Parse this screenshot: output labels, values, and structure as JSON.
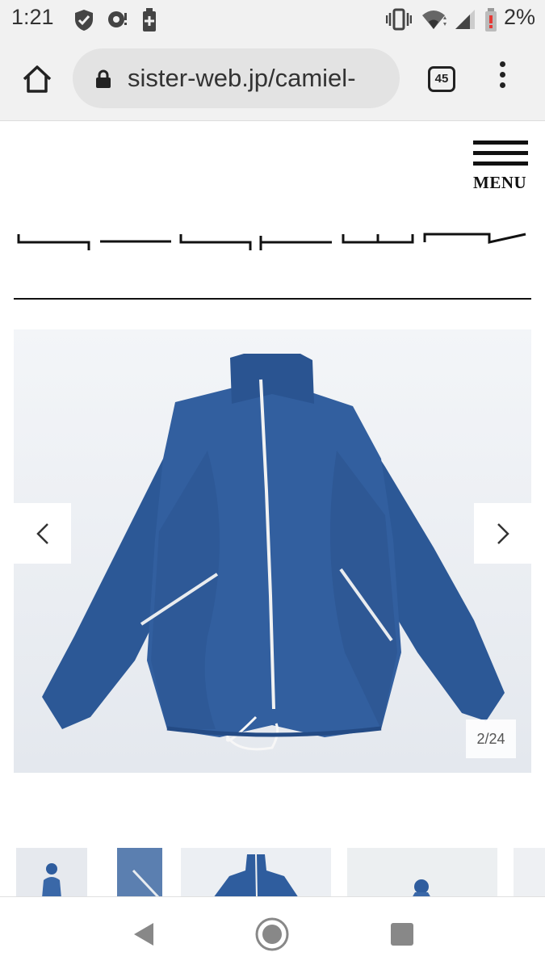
{
  "status_bar": {
    "time": "1:21",
    "battery_percent": "2%",
    "icons": [
      "shield-check-icon",
      "cast-icon",
      "battery-saver-icon",
      "vibrate-icon",
      "wifi-icon",
      "signal-icon",
      "battery-low-icon"
    ]
  },
  "browser": {
    "url": "sister-web.jp/camiel-",
    "tab_count": "45",
    "icons": [
      "home-icon",
      "lock-icon",
      "tab-switcher-icon",
      "more-vert-icon"
    ]
  },
  "header": {
    "menu_label": "MENU"
  },
  "carousel": {
    "counter": "2/24",
    "current_index": 2,
    "total": 24,
    "product_color": "#2f5d9e"
  },
  "colors": {
    "jacket_blue": "#2f5d9e",
    "background": "#ebeef2"
  },
  "nav_bar": {
    "icons": [
      "back-triangle-icon",
      "home-circle-icon",
      "recents-square-icon"
    ]
  }
}
